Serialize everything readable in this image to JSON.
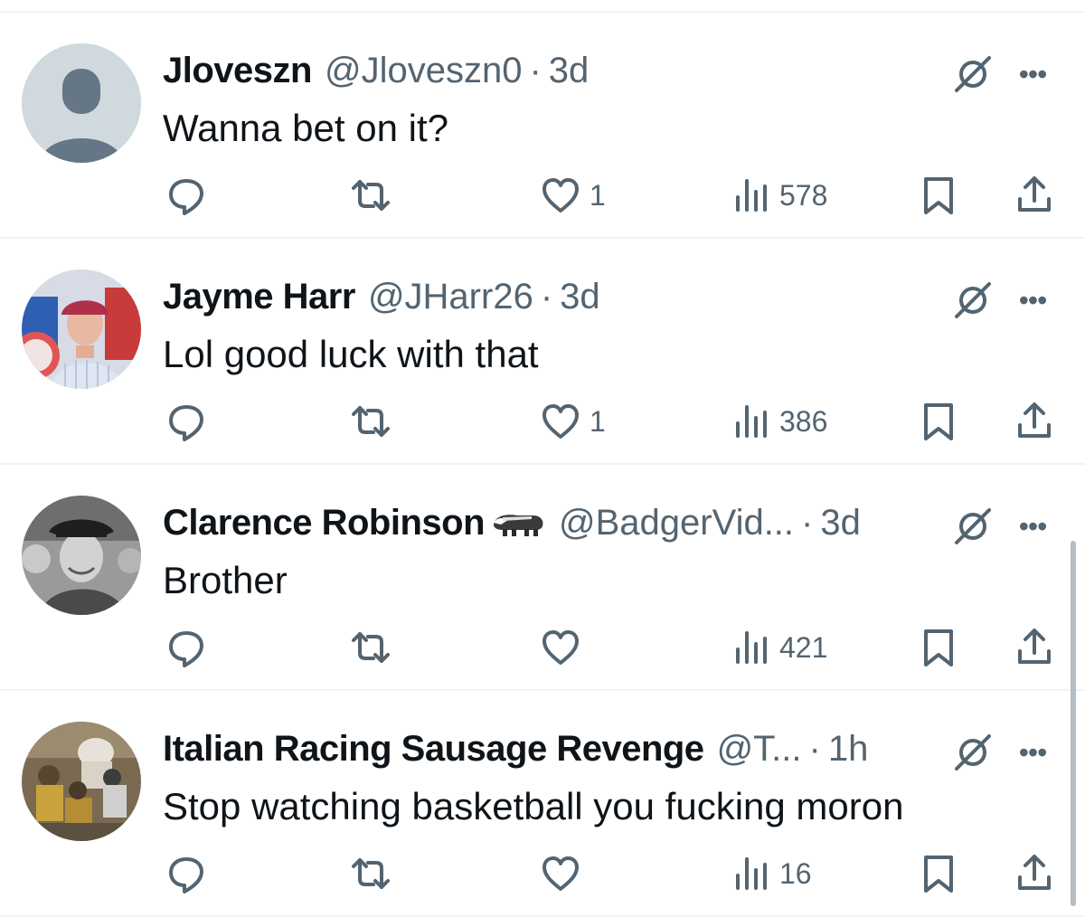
{
  "colors": {
    "text": "#0f1419",
    "secondary": "#536471",
    "divider": "#eff3f4"
  },
  "tweets": [
    {
      "name": "Jloveszn",
      "handle": "@Jloveszn0",
      "separator": "·",
      "time": "3d",
      "text": "Wanna bet on it?",
      "likes": "1",
      "views": "578",
      "avatar": "default-avatar"
    },
    {
      "name": "Jayme Harr",
      "handle": "@JHarr26",
      "separator": "·",
      "time": "3d",
      "text": "Lol good luck with that",
      "likes": "1",
      "views": "386",
      "avatar": "photo-avatar"
    },
    {
      "name": "Clarence Robinson",
      "name_emoji": "badger-emoji",
      "handle": "@BadgerVid...",
      "separator": "·",
      "time": "3d",
      "text": "Brother",
      "likes": "",
      "views": "421",
      "avatar": "photo-avatar"
    },
    {
      "name": "Italian Racing Sausage Revenge",
      "handle": "@T...",
      "separator": "·",
      "time": "1h",
      "text": "Stop watching basketball you fucking moron",
      "likes": "",
      "views": "16",
      "avatar": "photo-avatar"
    }
  ],
  "more_label": "•••"
}
